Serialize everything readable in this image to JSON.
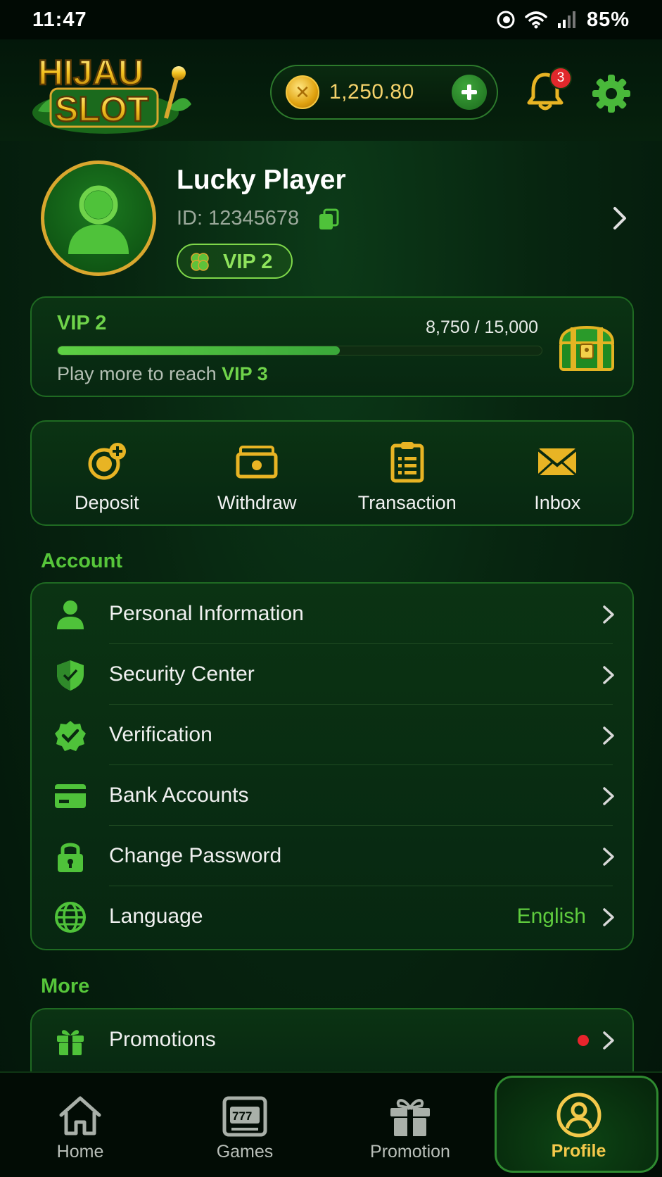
{
  "status_bar": {
    "time": "11:47",
    "battery": "85%"
  },
  "header": {
    "logo_line1": "HIJAU",
    "logo_line2": "SLOT",
    "balance": "1,250.80",
    "notification_count": "3"
  },
  "profile": {
    "name": "Lucky Player",
    "id_text": "ID: 12345678",
    "vip_badge": "VIP 2"
  },
  "vip_card": {
    "level": "VIP 2",
    "progress_text": "8,750 / 15,000",
    "progress_fraction": 0.583,
    "hint_prefix": "Play more to reach",
    "next_level": "VIP 3"
  },
  "quick_actions": [
    {
      "label": "Deposit"
    },
    {
      "label": "Withdraw"
    },
    {
      "label": "Transaction"
    },
    {
      "label": "Inbox"
    }
  ],
  "account": {
    "title": "Account",
    "items": [
      {
        "label": "Personal Information"
      },
      {
        "label": "Security Center"
      },
      {
        "label": "Verification"
      },
      {
        "label": "Bank Accounts"
      },
      {
        "label": "Change Password"
      },
      {
        "label": "Language",
        "value": "English"
      }
    ]
  },
  "more": {
    "title": "More",
    "items": [
      {
        "label": "Promotions"
      }
    ]
  },
  "bottom_nav": [
    {
      "label": "Home"
    },
    {
      "label": "Games"
    },
    {
      "label": "Promotion"
    },
    {
      "label": "Profile",
      "active": true
    }
  ],
  "colors": {
    "accent_green": "#56c63a",
    "gold": "#f4c94b",
    "background": "#072510"
  }
}
